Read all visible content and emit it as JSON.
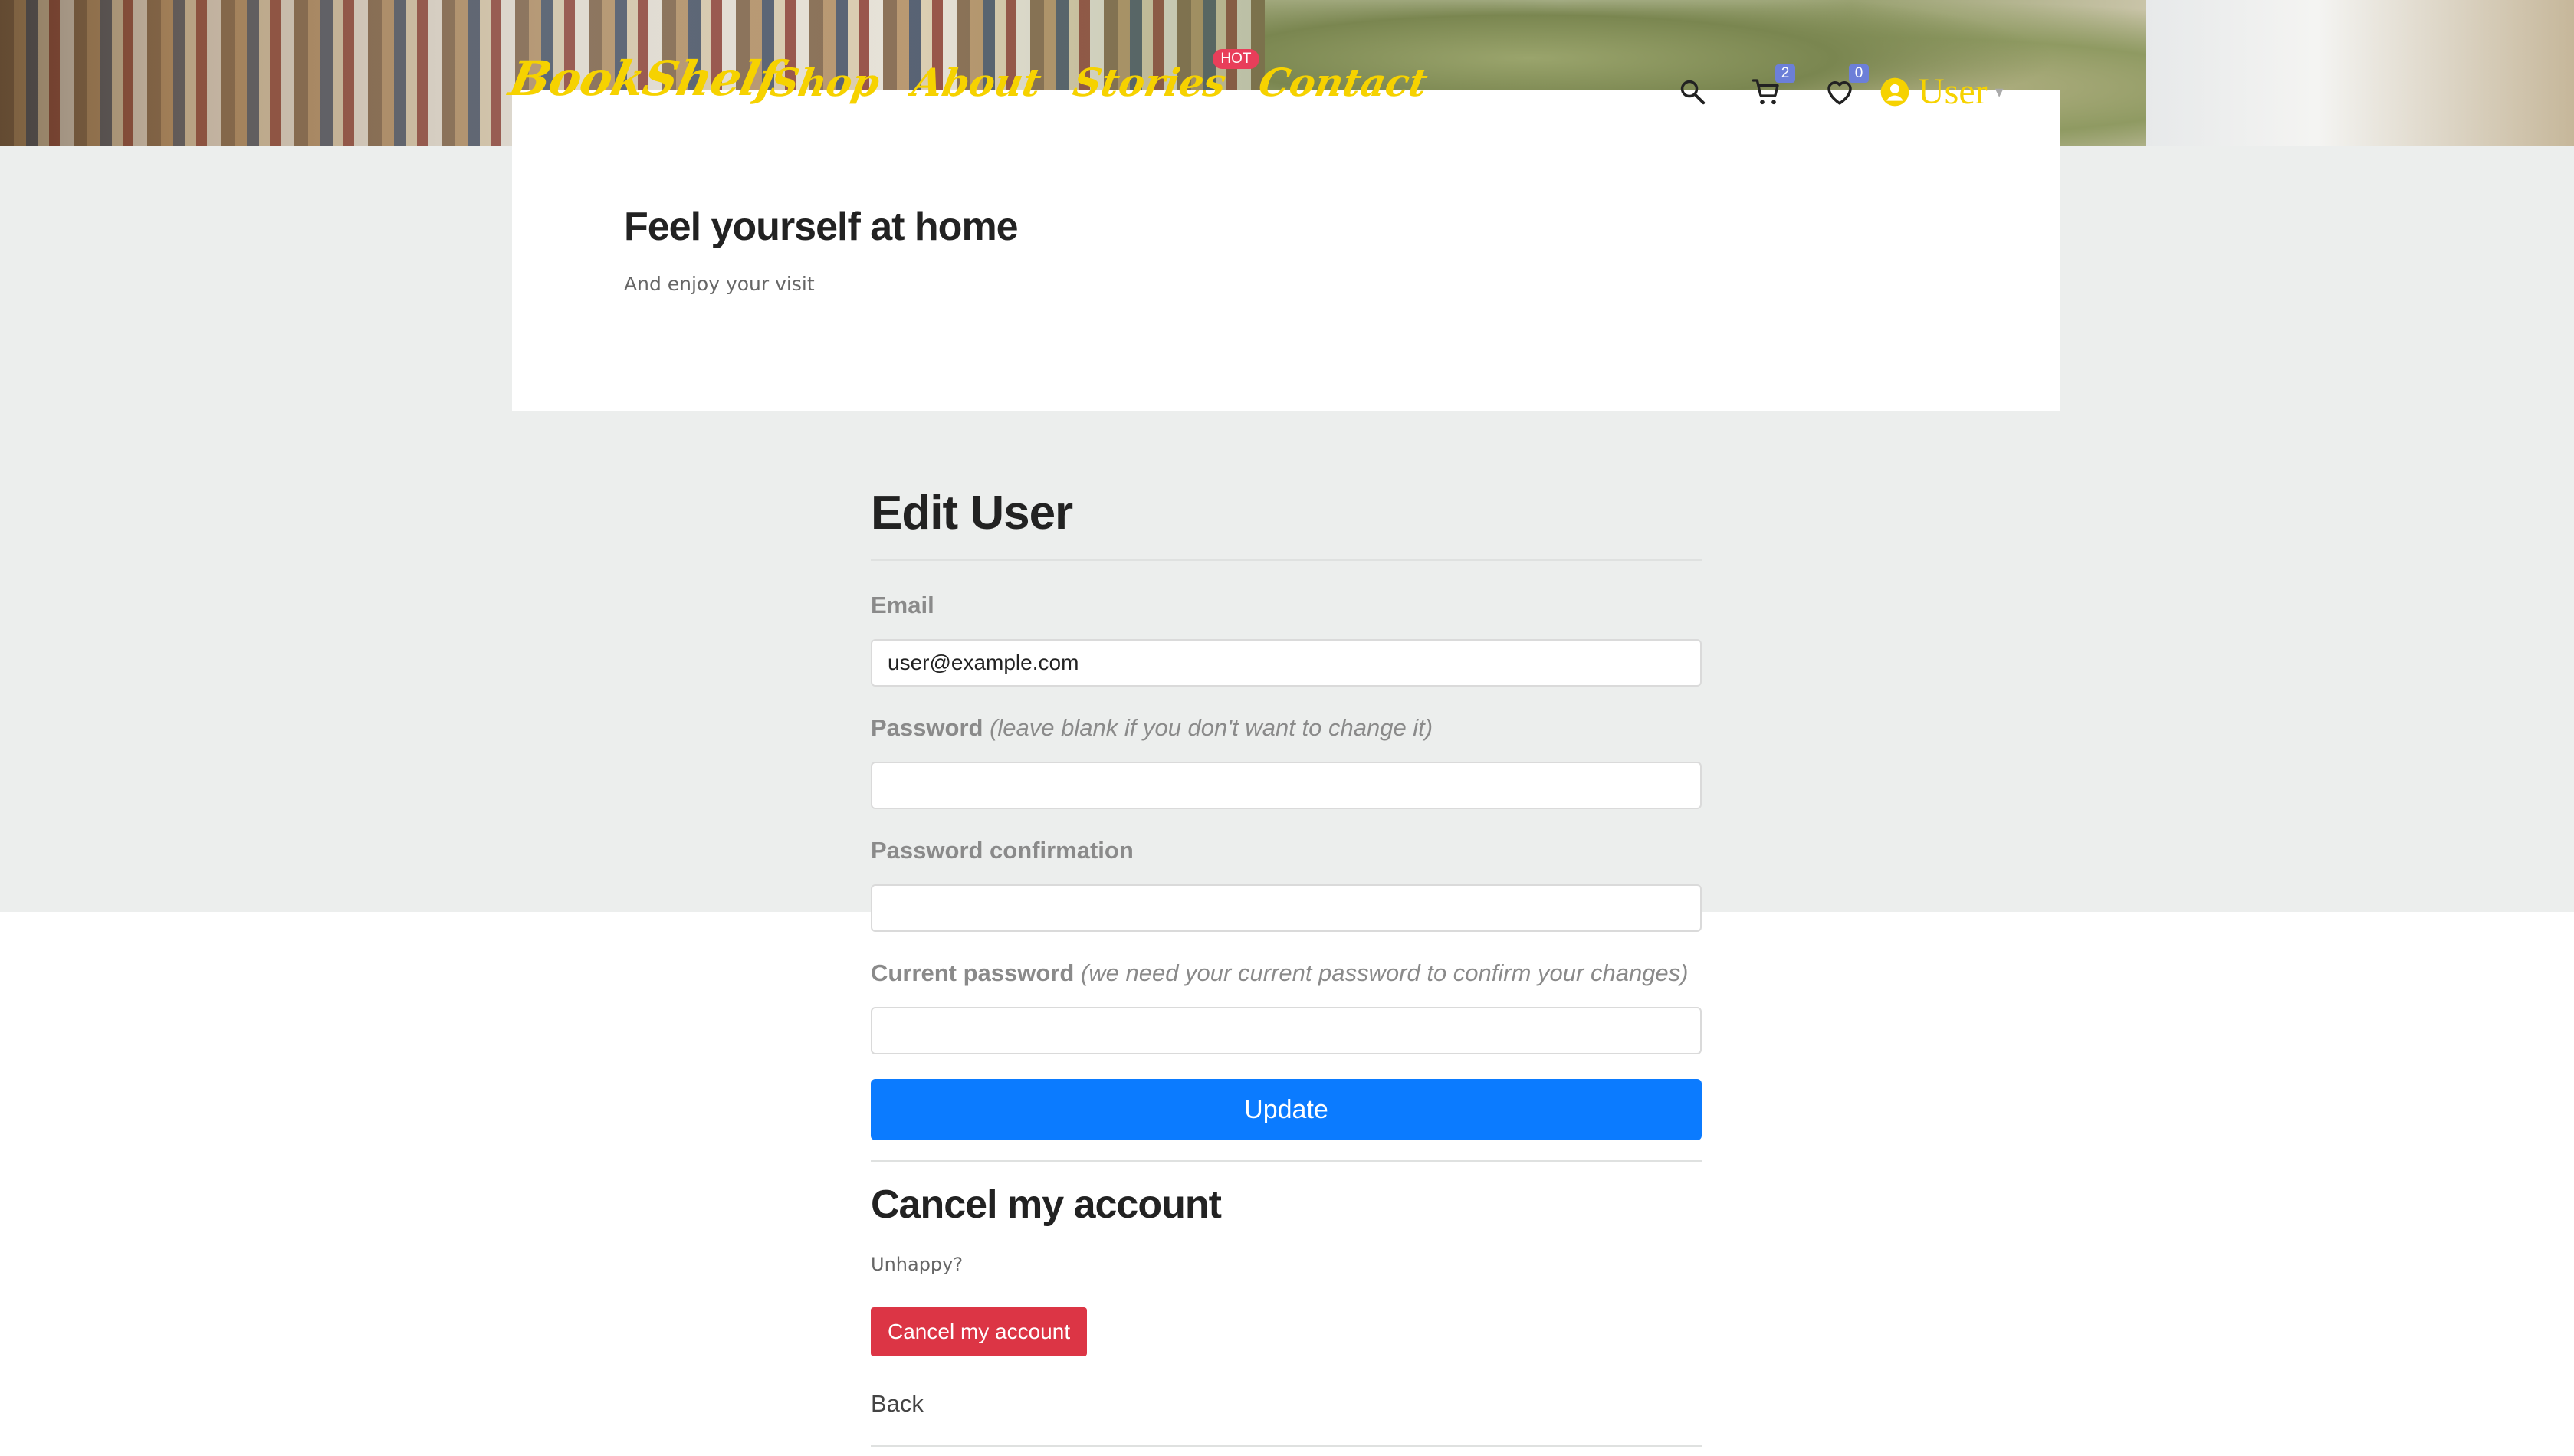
{
  "navbar": {
    "logo": "BookShelf",
    "links": [
      {
        "label": "Shop"
      },
      {
        "label": "About"
      },
      {
        "label": "Stories",
        "badge": "HOT"
      },
      {
        "label": "Contact"
      }
    ],
    "cart_count": "2",
    "wishlist_count": "0",
    "user_label": "User",
    "accent_color": "#f6d200",
    "icons": [
      "search-icon",
      "cart-icon",
      "heart-icon",
      "user-circle-icon",
      "chevron-down-icon"
    ]
  },
  "hero": {
    "title": "Feel yourself at home",
    "subtitle": "And enjoy your visit"
  },
  "form": {
    "title": "Edit User",
    "email": {
      "label": "Email",
      "value": "user@example.com"
    },
    "password": {
      "label": "Password",
      "hint": "(leave blank if you don't want to change it)",
      "value": ""
    },
    "password_confirmation": {
      "label": "Password confirmation",
      "value": ""
    },
    "current_password": {
      "label": "Current password",
      "hint": "(we need your current password to confirm your changes)",
      "value": ""
    },
    "submit_label": "Update",
    "submit_color": "#0b7bff"
  },
  "cancel_section": {
    "title": "Cancel my account",
    "text": "Unhappy?",
    "button_label": "Cancel my account",
    "button_color": "#dc3545"
  },
  "back_label": "Back"
}
